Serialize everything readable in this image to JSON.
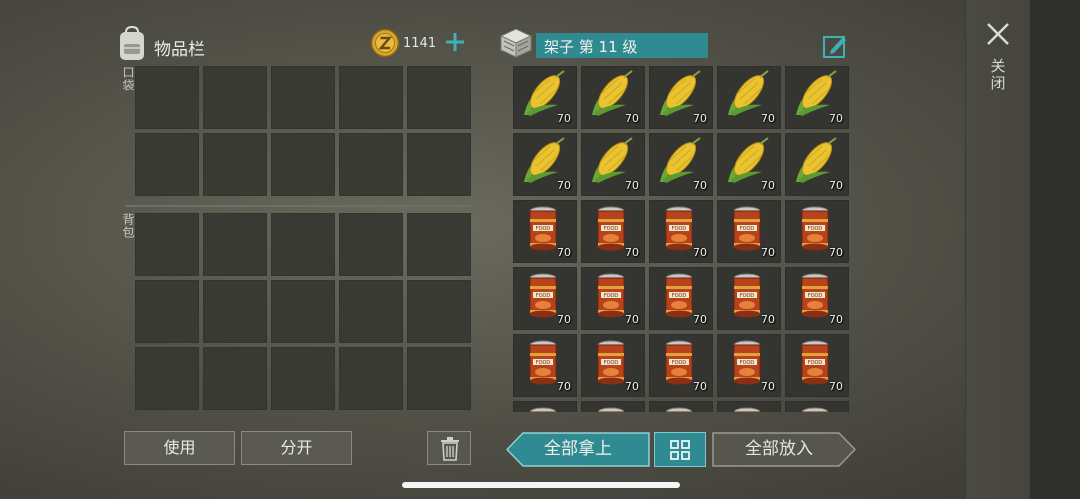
{
  "inventory": {
    "title": "物品栏",
    "coins": "1141",
    "pocket_label": "口袋",
    "backpack_label": "背包",
    "pocket_slots": 10,
    "backpack_slots": 15
  },
  "container": {
    "title": "架子 第 11 级",
    "items": [
      {
        "type": "corn",
        "qty": "70"
      },
      {
        "type": "corn",
        "qty": "70"
      },
      {
        "type": "corn",
        "qty": "70"
      },
      {
        "type": "corn",
        "qty": "70"
      },
      {
        "type": "corn",
        "qty": "70"
      },
      {
        "type": "corn",
        "qty": "70"
      },
      {
        "type": "corn",
        "qty": "70"
      },
      {
        "type": "corn",
        "qty": "70"
      },
      {
        "type": "corn",
        "qty": "70"
      },
      {
        "type": "corn",
        "qty": "70"
      },
      {
        "type": "can",
        "qty": "70"
      },
      {
        "type": "can",
        "qty": "70"
      },
      {
        "type": "can",
        "qty": "70"
      },
      {
        "type": "can",
        "qty": "70"
      },
      {
        "type": "can",
        "qty": "70"
      },
      {
        "type": "can",
        "qty": "70"
      },
      {
        "type": "can",
        "qty": "70"
      },
      {
        "type": "can",
        "qty": "70"
      },
      {
        "type": "can",
        "qty": "70"
      },
      {
        "type": "can",
        "qty": "70"
      },
      {
        "type": "can",
        "qty": "70"
      },
      {
        "type": "can",
        "qty": "70"
      },
      {
        "type": "can",
        "qty": "70"
      },
      {
        "type": "can",
        "qty": "70"
      },
      {
        "type": "can",
        "qty": "70"
      },
      {
        "type": "can",
        "qty": ""
      },
      {
        "type": "can",
        "qty": ""
      },
      {
        "type": "can",
        "qty": ""
      },
      {
        "type": "can",
        "qty": ""
      },
      {
        "type": "can",
        "qty": ""
      }
    ]
  },
  "buttons": {
    "use": "使用",
    "split": "分开",
    "take_all": "全部拿上",
    "put_all": "全部放入",
    "close": "关闭"
  },
  "colors": {
    "accent": "#2f8a91",
    "coin": "#d9a630"
  }
}
